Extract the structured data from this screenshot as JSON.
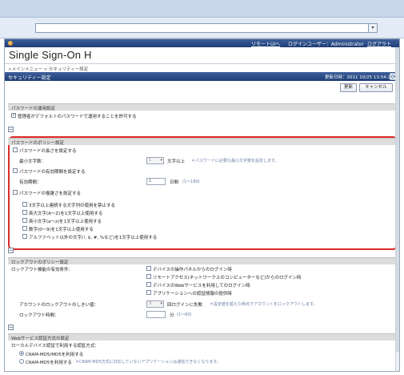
{
  "app": {
    "title": "Single Sign-On H",
    "remote_ui": "リモートUIへ",
    "login_user": "ログインユーザー：Administrator",
    "logout": "ログアウト",
    "breadcrumb": ">メインメニュー > セキュリティー設定"
  },
  "section": {
    "title": "セキュリティー設定",
    "updated": "更新日時：2011 10/25 13:54:22",
    "update_button": "更新",
    "cancel_button": "キャンセル"
  },
  "password_policy_use": {
    "header": "パスワードの運用設定",
    "allow_default_label": "管理者がデフォルトのパスワードで運用することを許可する",
    "allow_default_checked": true
  },
  "password_policy": {
    "header": "パスワードのポリシー設定",
    "length": {
      "label": "パスワードの長さを設定する",
      "min_label": "最小文字数：",
      "value": "1",
      "unit": "文字以上",
      "note": "＊パスワードに必要な最小文字数を設定します。"
    },
    "expiry": {
      "label": "パスワードの有効期間を設定する",
      "period_label": "有効期間：",
      "value": "1",
      "unit": "日間",
      "range": "(1～180)"
    },
    "complexity": {
      "label": "パスワードの複雑さを設定する",
      "options": [
        "3文字以上連続する文字列の使用を禁止する",
        "英大文字(A～Z)を1文字以上使用する",
        "英小文字(a～z)を1文字以上使用する",
        "数字(0～9)を1文字以上使用する",
        "アルファベット以外の文字(!, $, #, %など)を1文字以上使用する"
      ]
    }
  },
  "lockout_policy": {
    "header": "ロックアウトのポリシー設定",
    "cond_label": "ロックアウト機能の有効条件：",
    "conditions": [
      "デバイスの操作パネルからのログイン時",
      "リモートアクセス(ネットワーク上のコンピューターなど)からのログイン時",
      "デバイスのWebサービスを利用してのログイン時",
      "アプリケーションへの認証情報の提供時"
    ],
    "threshold_label": "アカウントのロックアウトのしきい値：",
    "threshold_value": "3",
    "threshold_unit": "回ログインに失敗",
    "threshold_note": "＊設定値を超えた時点でアカウントをロックアウトします。",
    "time_label": "ロックアウト時間：",
    "time_value": "",
    "time_unit": "分",
    "time_range": "(1～60)"
  },
  "web_auth": {
    "header": "Webサービス認証方式の設定",
    "method_label": "ローカルデバイス認証で利用する認証方式：",
    "options": [
      "CRAM-MD5/MD5を利用する",
      "CRAM-MD5を利用する"
    ],
    "selected": 0,
    "note": "＊CRAM-MD5方式に対応していないアプリケーションは通信できなくなります。"
  }
}
